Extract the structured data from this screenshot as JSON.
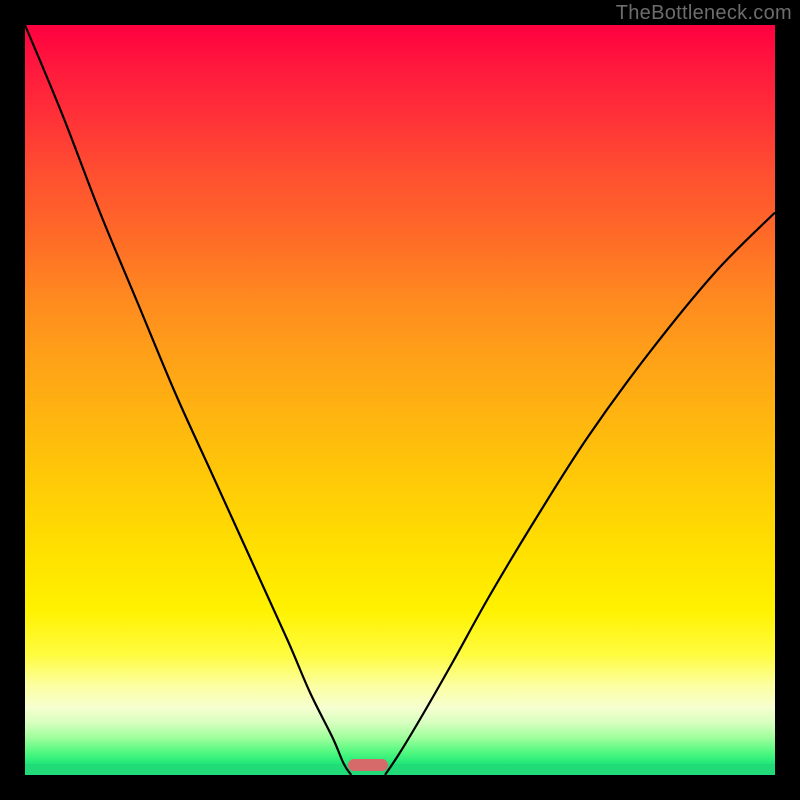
{
  "watermark": {
    "text": "TheBottleneck.com"
  },
  "chart_data": {
    "type": "line",
    "title": "",
    "xlabel": "",
    "ylabel": "",
    "xlim": [
      0,
      100
    ],
    "ylim": [
      0,
      100
    ],
    "grid": false,
    "series": [
      {
        "name": "left-curve",
        "x": [
          0,
          5,
          10,
          15,
          20,
          25,
          30,
          35,
          38,
          41,
          42.5,
          43.5
        ],
        "y": [
          100,
          88,
          75,
          63,
          51,
          40,
          29,
          18,
          11,
          5,
          1.5,
          0
        ]
      },
      {
        "name": "right-curve",
        "x": [
          48,
          50,
          53,
          57,
          62,
          68,
          75,
          83,
          92,
          100
        ],
        "y": [
          0,
          3,
          8,
          15,
          24,
          34,
          45,
          56,
          67,
          75
        ]
      }
    ],
    "pill": {
      "x_center_pct": 45.7,
      "width_pct": 5.3
    },
    "gradient_stops": [
      {
        "pct": 0,
        "color": "#ff0040"
      },
      {
        "pct": 50,
        "color": "#ffb000"
      },
      {
        "pct": 85,
        "color": "#ffff60"
      },
      {
        "pct": 100,
        "color": "#20e070"
      }
    ]
  }
}
